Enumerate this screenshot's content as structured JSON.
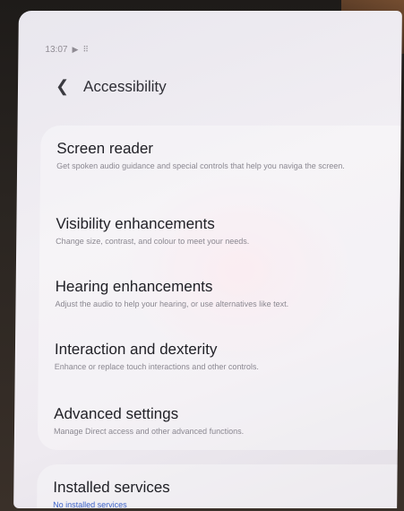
{
  "status_bar": {
    "time": "13:07",
    "icons": [
      "media-icon",
      "grid-icon"
    ]
  },
  "header": {
    "back_icon": "chevron-left-icon",
    "title": "Accessibility"
  },
  "settings": [
    {
      "title": "Screen reader",
      "description": "Get spoken audio guidance and special controls that help you naviga the screen."
    },
    {
      "title": "Visibility enhancements",
      "description": "Change size, contrast, and colour to meet your needs."
    },
    {
      "title": "Hearing enhancements",
      "description": "Adjust the audio to help your hearing, or use alternatives like text."
    },
    {
      "title": "Interaction and dexterity",
      "description": "Enhance or replace touch interactions and other controls."
    },
    {
      "title": "Advanced settings",
      "description": "Manage Direct access and other advanced functions."
    }
  ],
  "installed_services": {
    "title": "Installed services",
    "status": "No installed services"
  },
  "colors": {
    "accent": "#3d63c9",
    "title_text": "#222228",
    "secondary_text": "#8a8790"
  }
}
